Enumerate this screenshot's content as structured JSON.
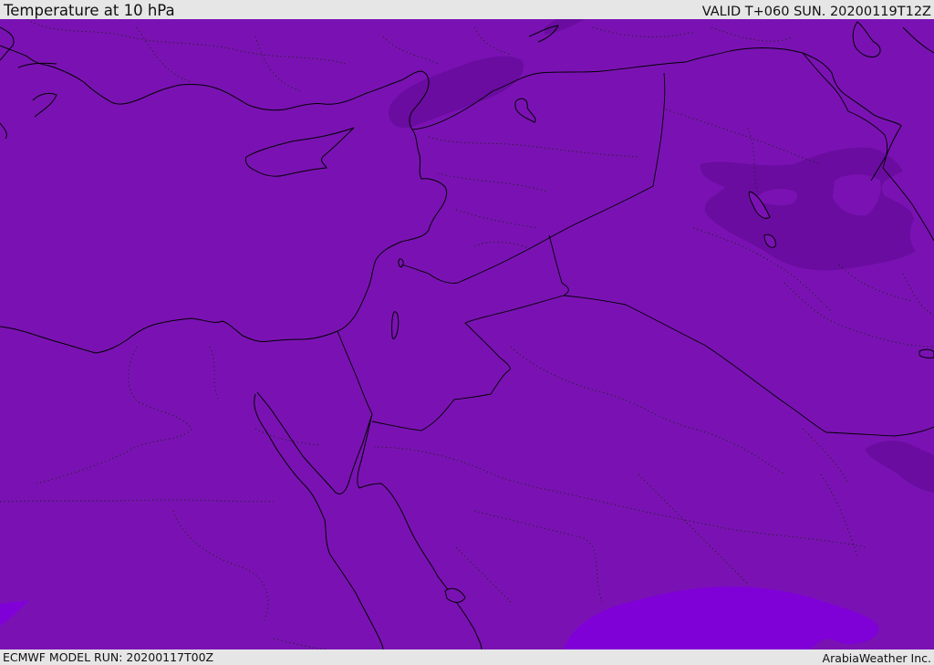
{
  "header": {
    "title": "Temperature at 10 hPa",
    "valid_time": "VALID T+060 SUN. 20200119T12Z"
  },
  "footer": {
    "model_run": "ECMWF MODEL RUN: 20200117T00Z",
    "credit": "ArabiaWeather Inc."
  },
  "map": {
    "colors": {
      "background_field": "#7a12b3",
      "colder_band": "#6a0ca0",
      "warmer_band": "#8000d8",
      "lines": "#000000"
    }
  }
}
